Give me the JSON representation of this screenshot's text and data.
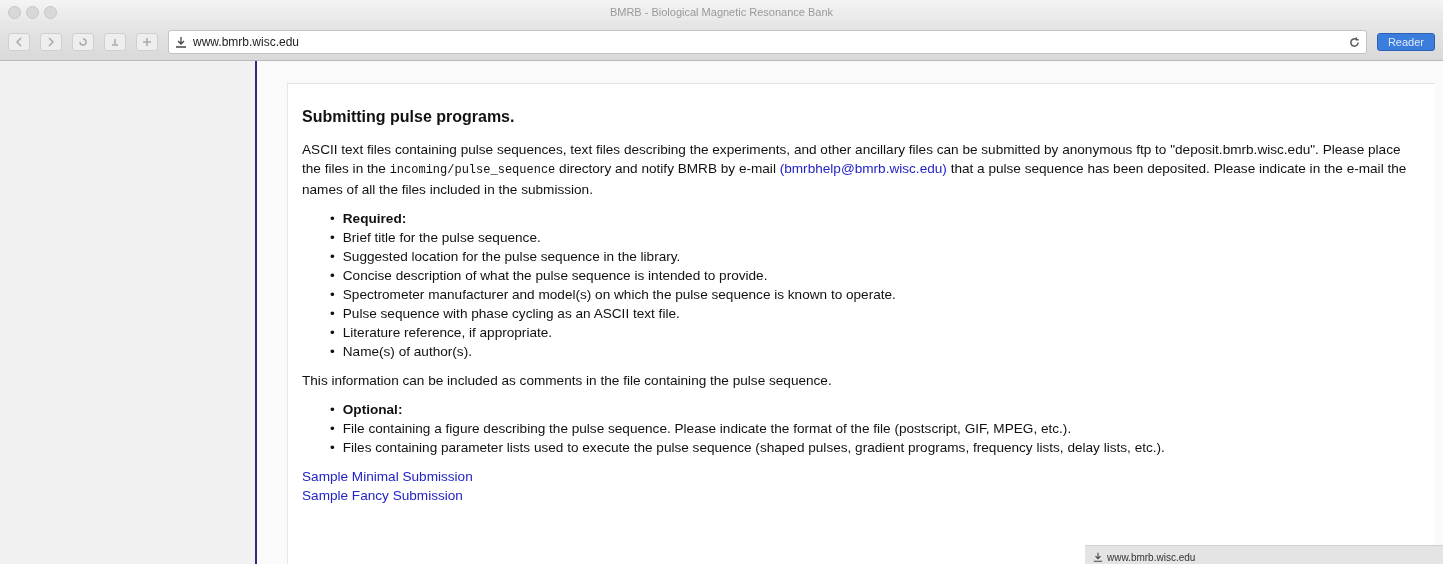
{
  "window": {
    "title": "BMRB - Biological Magnetic Resonance Bank"
  },
  "toolbar": {
    "url": "www.bmrb.wisc.edu",
    "reader_button": "Reader"
  },
  "content": {
    "heading": "Submitting pulse programs.",
    "intro": [
      {
        "kind": "plain",
        "text": "ASCII text files containing pulse sequences, text files describing the experiments, and other ancillary files can be submitted by anonymous ftp to \"deposit.bmrb.wisc.edu\". Please place the files in the "
      },
      {
        "kind": "code",
        "text": "incoming/pulse_sequence"
      },
      {
        "kind": "plain",
        "text": " directory and notify BMRB by e-mail "
      },
      {
        "kind": "link",
        "text": "(bmrbhelp@bmrb.wisc.edu)"
      },
      {
        "kind": "plain",
        "text": " that a pulse sequence has been deposited. Please indicate in the e-mail the names of all the files included in the submission."
      }
    ],
    "required": [
      {
        "kind": "heading",
        "text": "Required:"
      },
      {
        "kind": "item",
        "text": "Brief title for the pulse sequence."
      },
      {
        "kind": "item",
        "text": "Suggested location for the pulse sequence in the library."
      },
      {
        "kind": "item",
        "text": "Concise description of what the pulse sequence is intended to provide."
      },
      {
        "kind": "item",
        "text": "Spectrometer manufacturer and model(s) on which the pulse sequence is known to operate."
      },
      {
        "kind": "item",
        "text": "Pulse sequence with phase cycling as an ASCII text file."
      },
      {
        "kind": "item",
        "text": "Literature reference, if appropriate."
      },
      {
        "kind": "item",
        "text": "Name(s) of author(s)."
      }
    ],
    "note": "This information can be included as comments in the file containing the pulse sequence.",
    "optional": [
      {
        "kind": "heading",
        "text": "Optional:"
      },
      {
        "kind": "item",
        "text": "File containing a figure describing the pulse sequence. Please indicate the format of the file (postscript, GIF, MPEG, etc.)."
      },
      {
        "kind": "item",
        "text": "Files containing parameter lists used to execute the pulse sequence (shaped pulses, gradient programs, frequency lists, delay lists, etc.)."
      }
    ],
    "bullet": "•",
    "links": [
      "Sample Minimal Submission",
      "Sample Fancy Submission"
    ]
  },
  "thumbnail": {
    "url": "www.bmrb.wisc.edu"
  }
}
